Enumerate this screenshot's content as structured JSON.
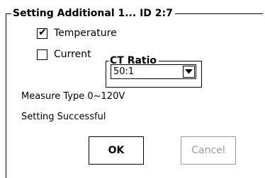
{
  "dialog": {
    "title": "Setting Additional 1... ID 2:7"
  },
  "options": {
    "temperature": {
      "label": "Temperature",
      "checked": true
    },
    "current": {
      "label": "Current",
      "checked": false
    }
  },
  "ct_ratio": {
    "label": "CT Ratio",
    "selected": "50:1"
  },
  "info": {
    "measure_type": "Measure Type 0~120V",
    "status": "Setting Successful"
  },
  "buttons": {
    "ok_label": "OK",
    "cancel_label": "Cancel"
  },
  "colors": {
    "disabled_text": "#9a9a9a"
  }
}
